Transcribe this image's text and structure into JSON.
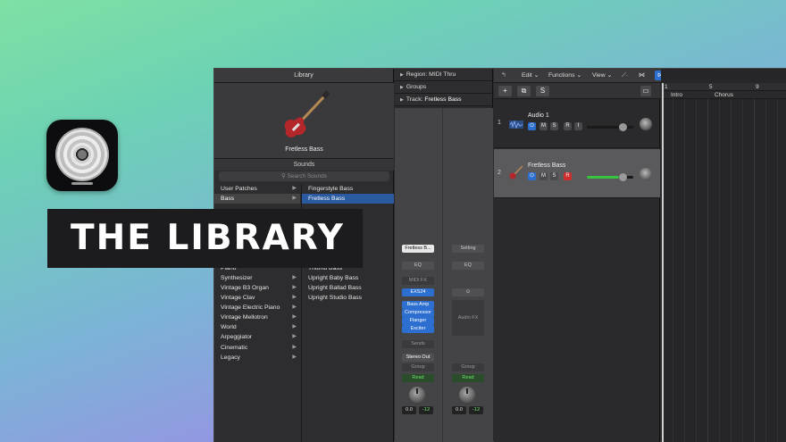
{
  "banner": {
    "title": "THE LIBRARY"
  },
  "library": {
    "header": "Library",
    "preview_name": "Fretless Bass",
    "sounds_label": "Sounds",
    "search_placeholder": "Search Sounds",
    "categories": [
      {
        "label": "User Patches",
        "arrow": "▶"
      },
      {
        "label": "Bass",
        "arrow": "▶"
      },
      {
        "label": "",
        "arrow": ""
      },
      {
        "label": "",
        "arrow": ""
      },
      {
        "label": "",
        "arrow": ""
      },
      {
        "label": "",
        "arrow": ""
      },
      {
        "label": "",
        "arrow": ""
      },
      {
        "label": "",
        "arrow": ""
      },
      {
        "label": "Piano",
        "arrow": ""
      },
      {
        "label": "Synthesizer",
        "arrow": "▶"
      },
      {
        "label": "Vintage B3 Organ",
        "arrow": "▶"
      },
      {
        "label": "Vintage Clav",
        "arrow": "▶"
      },
      {
        "label": "Vintage Electric Piano",
        "arrow": "▶"
      },
      {
        "label": "Vintage Mellotron",
        "arrow": "▶"
      },
      {
        "label": "World",
        "arrow": "▶"
      },
      {
        "label": "Arpeggiator",
        "arrow": "▶"
      },
      {
        "label": "Cinematic",
        "arrow": "▶"
      },
      {
        "label": "Legacy",
        "arrow": "▶"
      }
    ],
    "items": [
      "Fingerstyle Bass",
      "Fretless Bass",
      "",
      "",
      "",
      "",
      "",
      "",
      "Thumb Bass",
      "Upright Baby Bass",
      "Upright Ballad Bass",
      "Upright Studio Bass"
    ]
  },
  "inspector": {
    "region": "Region: MIDI Thru",
    "groups": "Groups",
    "track_label": "Track:",
    "track_name": "Fretless Bass",
    "strip1": {
      "setting": "Fretless B...",
      "eq": "EQ",
      "midi_fx": "MIDI FX",
      "instrument": "EXS24",
      "fx": [
        "Bass Amp",
        "Compressor",
        "Flanger",
        "Exciter"
      ],
      "sends": "Sends",
      "output": "Stereo Out",
      "group": "Group",
      "automation": "Read",
      "volume": "0.0",
      "peak": "-12"
    },
    "strip2": {
      "setting": "Setting",
      "eq": "EQ",
      "link_icon": "link-icon",
      "audio_fx": "Audio FX",
      "group": "Group",
      "automation": "Read",
      "volume": "0.0",
      "peak": "-12"
    }
  },
  "toolbar": {
    "edit": "Edit",
    "functions": "Functions",
    "view": "View"
  },
  "tracks": [
    {
      "num": "1",
      "name": "Audio 1",
      "icon": "waveform-icon",
      "m": "M",
      "s": "S",
      "r": "R",
      "i": "I",
      "volume": 0.75
    },
    {
      "num": "2",
      "name": "Fretless Bass",
      "icon": "bass-guitar-icon",
      "m": "M",
      "s": "S",
      "r": "R",
      "volume": 0.75
    }
  ],
  "timeline": {
    "bars": [
      "1",
      "5",
      "9"
    ],
    "markers": [
      "Intro",
      "Chorus"
    ]
  },
  "colors": {
    "accent": "#2c6fd1",
    "record": "#d02c2c",
    "meter": "#39c43f"
  }
}
